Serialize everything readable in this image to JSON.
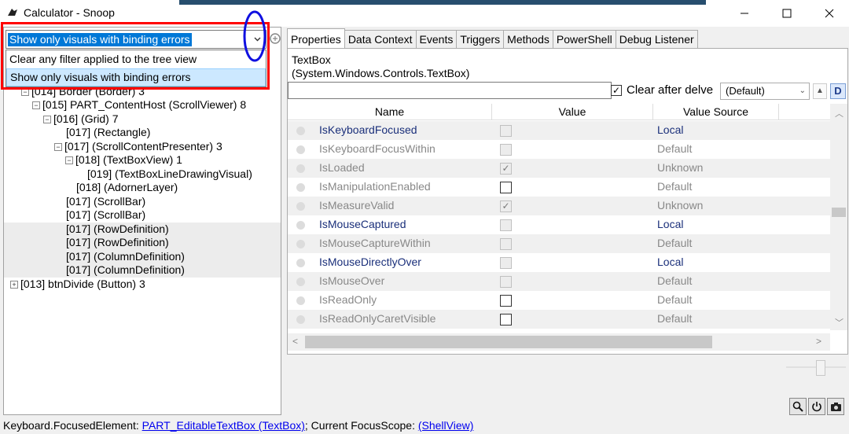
{
  "window": {
    "title": "Calculator - Snoop"
  },
  "filter": {
    "selected": "Show only visuals with binding errors",
    "options": [
      "Clear any filter applied to the tree view",
      "Show only visuals with binding errors"
    ]
  },
  "tree": {
    "partial_row": "[014] Border (Border) 3",
    "rows": [
      "[015] PART_ContentHost (ScrollViewer) 8",
      "[016]  (Grid) 7",
      "[017]  (Rectangle)",
      "[017]  (ScrollContentPresenter) 3",
      "[018]  (TextBoxView) 1",
      "[019]  (TextBoxLineDrawingVisual)",
      "[018]  (AdornerLayer)",
      "[017]  (ScrollBar)",
      "[017]  (ScrollBar)",
      "[017]  (RowDefinition)",
      "[017]  (RowDefinition)",
      "[017]  (ColumnDefinition)",
      "[017]  (ColumnDefinition)",
      "[013] btnDivide (Button) 3"
    ]
  },
  "tabs": [
    "Properties",
    "Data Context",
    "Events",
    "Triggers",
    "Methods",
    "PowerShell",
    "Debug Listener"
  ],
  "properties": {
    "object_name": "TextBox",
    "object_type": "(System.Windows.Controls.TextBox)",
    "clear_after_delve_label": "Clear after delve",
    "view_mode": "(Default)",
    "d_button": "D",
    "columns": {
      "name": "Name",
      "value": "Value",
      "source": "Value Source"
    },
    "rows": [
      {
        "name": "IsKeyboardFocused",
        "source": "Local"
      },
      {
        "name": "IsKeyboardFocusWithin",
        "source": "Default"
      },
      {
        "name": "IsLoaded",
        "source": "Unknown"
      },
      {
        "name": "IsManipulationEnabled",
        "source": "Default"
      },
      {
        "name": "IsMeasureValid",
        "source": "Unknown"
      },
      {
        "name": "IsMouseCaptured",
        "source": "Local"
      },
      {
        "name": "IsMouseCaptureWithin",
        "source": "Default"
      },
      {
        "name": "IsMouseDirectlyOver",
        "source": "Local"
      },
      {
        "name": "IsMouseOver",
        "source": "Default"
      },
      {
        "name": "IsReadOnly",
        "source": "Default"
      },
      {
        "name": "IsReadOnlyCaretVisible",
        "source": "Default"
      }
    ]
  },
  "status": {
    "focused_label": "Keyboard.FocusedElement:",
    "focused_link": "PART_EditableTextBox (TextBox)",
    "scope_label": "; Current FocusScope:",
    "scope_link": "(ShellView)"
  },
  "icons": {
    "app": "snoop-icon",
    "minimize": "minimize-icon",
    "maximize": "maximize-icon",
    "close": "close-icon",
    "zoom": "magnifier-icon",
    "power": "power-icon",
    "screenshot": "camera-icon"
  },
  "colors": {
    "selection": "#0078d7",
    "highlight_box": "#ff0000",
    "annotation": "#1010e0",
    "local_source": "#1a2f7a"
  }
}
